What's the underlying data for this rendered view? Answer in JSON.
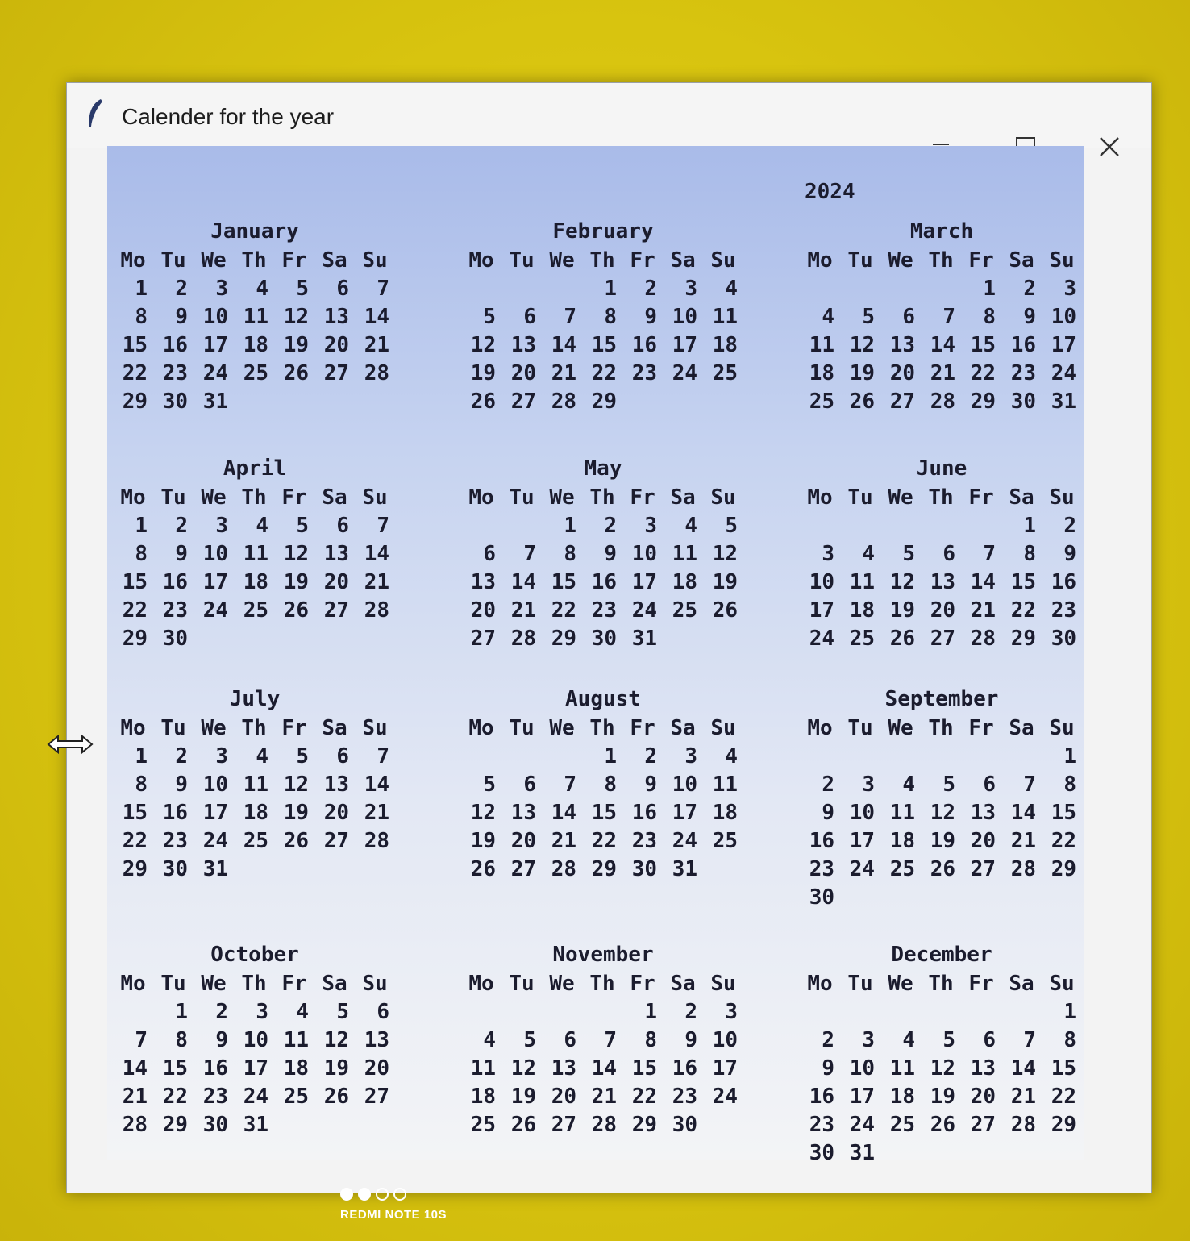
{
  "window": {
    "title": "Calender for the year",
    "icon": "feather-icon"
  },
  "title_buttons": {
    "minimize": "—",
    "maximize": "☐",
    "close": "✕"
  },
  "calendar": {
    "year": "2024",
    "weekdays": [
      "Mo",
      "Tu",
      "We",
      "Th",
      "Fr",
      "Sa",
      "Su"
    ],
    "months": [
      {
        "name": "January",
        "weeks": [
          [
            "1",
            "2",
            "3",
            "4",
            "5",
            "6",
            "7"
          ],
          [
            "8",
            "9",
            "10",
            "11",
            "12",
            "13",
            "14"
          ],
          [
            "15",
            "16",
            "17",
            "18",
            "19",
            "20",
            "21"
          ],
          [
            "22",
            "23",
            "24",
            "25",
            "26",
            "27",
            "28"
          ],
          [
            "29",
            "30",
            "31",
            "",
            "",
            "",
            ""
          ]
        ]
      },
      {
        "name": "February",
        "weeks": [
          [
            "",
            "",
            "",
            "1",
            "2",
            "3",
            "4"
          ],
          [
            "5",
            "6",
            "7",
            "8",
            "9",
            "10",
            "11"
          ],
          [
            "12",
            "13",
            "14",
            "15",
            "16",
            "17",
            "18"
          ],
          [
            "19",
            "20",
            "21",
            "22",
            "23",
            "24",
            "25"
          ],
          [
            "26",
            "27",
            "28",
            "29",
            "",
            "",
            ""
          ]
        ]
      },
      {
        "name": "March",
        "weeks": [
          [
            "",
            "",
            "",
            "",
            "1",
            "2",
            "3"
          ],
          [
            "4",
            "5",
            "6",
            "7",
            "8",
            "9",
            "10"
          ],
          [
            "11",
            "12",
            "13",
            "14",
            "15",
            "16",
            "17"
          ],
          [
            "18",
            "19",
            "20",
            "21",
            "22",
            "23",
            "24"
          ],
          [
            "25",
            "26",
            "27",
            "28",
            "29",
            "30",
            "31"
          ]
        ]
      },
      {
        "name": "April",
        "weeks": [
          [
            "1",
            "2",
            "3",
            "4",
            "5",
            "6",
            "7"
          ],
          [
            "8",
            "9",
            "10",
            "11",
            "12",
            "13",
            "14"
          ],
          [
            "15",
            "16",
            "17",
            "18",
            "19",
            "20",
            "21"
          ],
          [
            "22",
            "23",
            "24",
            "25",
            "26",
            "27",
            "28"
          ],
          [
            "29",
            "30",
            "",
            "",
            "",
            "",
            ""
          ]
        ]
      },
      {
        "name": "May",
        "weeks": [
          [
            "",
            "",
            "1",
            "2",
            "3",
            "4",
            "5"
          ],
          [
            "6",
            "7",
            "8",
            "9",
            "10",
            "11",
            "12"
          ],
          [
            "13",
            "14",
            "15",
            "16",
            "17",
            "18",
            "19"
          ],
          [
            "20",
            "21",
            "22",
            "23",
            "24",
            "25",
            "26"
          ],
          [
            "27",
            "28",
            "29",
            "30",
            "31",
            "",
            ""
          ]
        ]
      },
      {
        "name": "June",
        "weeks": [
          [
            "",
            "",
            "",
            "",
            "",
            "1",
            "2"
          ],
          [
            "3",
            "4",
            "5",
            "6",
            "7",
            "8",
            "9"
          ],
          [
            "10",
            "11",
            "12",
            "13",
            "14",
            "15",
            "16"
          ],
          [
            "17",
            "18",
            "19",
            "20",
            "21",
            "22",
            "23"
          ],
          [
            "24",
            "25",
            "26",
            "27",
            "28",
            "29",
            "30"
          ]
        ]
      },
      {
        "name": "July",
        "weeks": [
          [
            "1",
            "2",
            "3",
            "4",
            "5",
            "6",
            "7"
          ],
          [
            "8",
            "9",
            "10",
            "11",
            "12",
            "13",
            "14"
          ],
          [
            "15",
            "16",
            "17",
            "18",
            "19",
            "20",
            "21"
          ],
          [
            "22",
            "23",
            "24",
            "25",
            "26",
            "27",
            "28"
          ],
          [
            "29",
            "30",
            "31",
            "",
            "",
            "",
            ""
          ]
        ]
      },
      {
        "name": "August",
        "weeks": [
          [
            "",
            "",
            "",
            "1",
            "2",
            "3",
            "4"
          ],
          [
            "5",
            "6",
            "7",
            "8",
            "9",
            "10",
            "11"
          ],
          [
            "12",
            "13",
            "14",
            "15",
            "16",
            "17",
            "18"
          ],
          [
            "19",
            "20",
            "21",
            "22",
            "23",
            "24",
            "25"
          ],
          [
            "26",
            "27",
            "28",
            "29",
            "30",
            "31",
            ""
          ]
        ]
      },
      {
        "name": "September",
        "weeks": [
          [
            "",
            "",
            "",
            "",
            "",
            "",
            "1"
          ],
          [
            "2",
            "3",
            "4",
            "5",
            "6",
            "7",
            "8"
          ],
          [
            "9",
            "10",
            "11",
            "12",
            "13",
            "14",
            "15"
          ],
          [
            "16",
            "17",
            "18",
            "19",
            "20",
            "21",
            "22"
          ],
          [
            "23",
            "24",
            "25",
            "26",
            "27",
            "28",
            "29"
          ],
          [
            "30",
            "",
            "",
            "",
            "",
            "",
            ""
          ]
        ]
      },
      {
        "name": "October",
        "weeks": [
          [
            "",
            "1",
            "2",
            "3",
            "4",
            "5",
            "6"
          ],
          [
            "7",
            "8",
            "9",
            "10",
            "11",
            "12",
            "13"
          ],
          [
            "14",
            "15",
            "16",
            "17",
            "18",
            "19",
            "20"
          ],
          [
            "21",
            "22",
            "23",
            "24",
            "25",
            "26",
            "27"
          ],
          [
            "28",
            "29",
            "30",
            "31",
            "",
            "",
            ""
          ]
        ]
      },
      {
        "name": "November",
        "weeks": [
          [
            "",
            "",
            "",
            "",
            "1",
            "2",
            "3"
          ],
          [
            "4",
            "5",
            "6",
            "7",
            "8",
            "9",
            "10"
          ],
          [
            "11",
            "12",
            "13",
            "14",
            "15",
            "16",
            "17"
          ],
          [
            "18",
            "19",
            "20",
            "21",
            "22",
            "23",
            "24"
          ],
          [
            "25",
            "26",
            "27",
            "28",
            "29",
            "30",
            ""
          ]
        ]
      },
      {
        "name": "December",
        "weeks": [
          [
            "",
            "",
            "",
            "",
            "",
            "",
            "1"
          ],
          [
            "2",
            "3",
            "4",
            "5",
            "6",
            "7",
            "8"
          ],
          [
            "9",
            "10",
            "11",
            "12",
            "13",
            "14",
            "15"
          ],
          [
            "16",
            "17",
            "18",
            "19",
            "20",
            "21",
            "22"
          ],
          [
            "23",
            "24",
            "25",
            "26",
            "27",
            "28",
            "29"
          ],
          [
            "30",
            "31",
            "",
            "",
            "",
            "",
            ""
          ]
        ]
      }
    ]
  },
  "phone_watermark": {
    "brand": "REDMI NOTE 10S",
    "dots_filled": 2,
    "dots_total": 4
  },
  "cursor": "resize-horizontal-cursor-icon"
}
